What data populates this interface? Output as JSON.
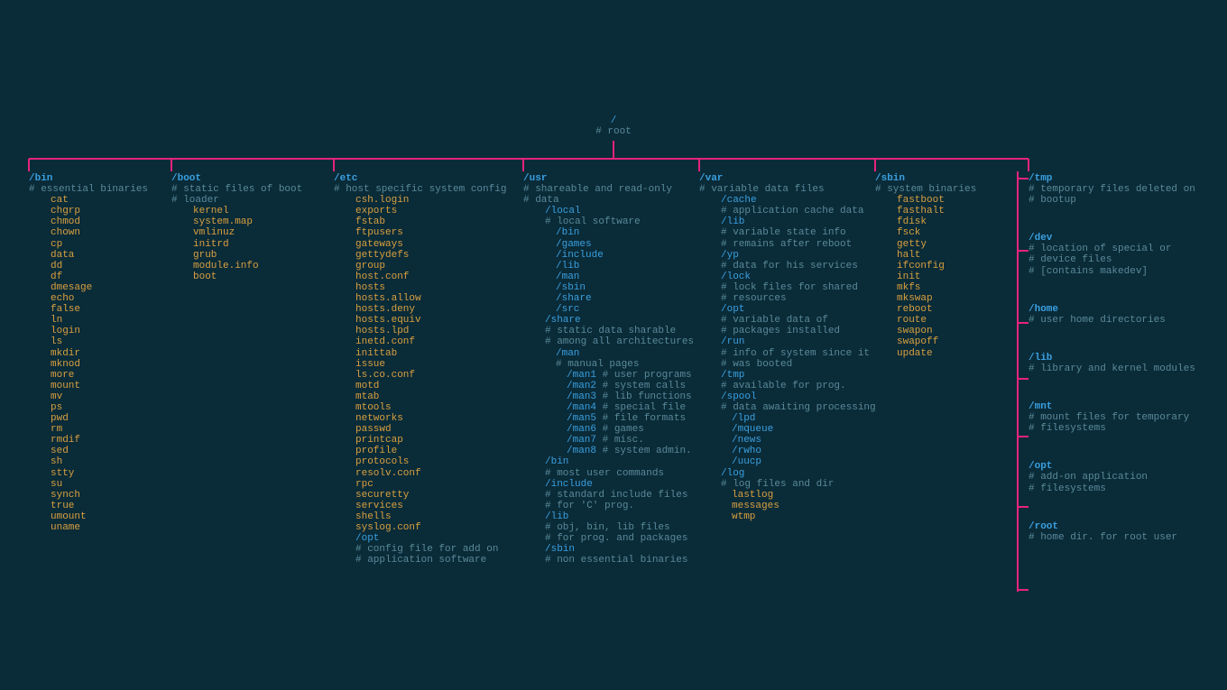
{
  "root": {
    "path": "/",
    "comment": "# root"
  },
  "bin": {
    "path": "/bin",
    "comment": "# essential binaries",
    "files": [
      "cat",
      "chgrp",
      "chmod",
      "chown",
      "cp",
      "data",
      "dd",
      "df",
      "dmesage",
      "echo",
      "false",
      "ln",
      "login",
      "ls",
      "mkdir",
      "mknod",
      "more",
      "mount",
      "mv",
      "ps",
      "pwd",
      "rm",
      "rmdif",
      "sed",
      "sh",
      "stty",
      "su",
      "synch",
      "true",
      "umount",
      "uname"
    ]
  },
  "boot": {
    "path": "/boot",
    "comments": [
      "# static files of boot",
      "# loader"
    ],
    "files": [
      "kernel",
      "system.map",
      "vmlinuz",
      "initrd",
      "grub",
      "module.info",
      "boot"
    ]
  },
  "etc": {
    "path": "/etc",
    "comment": "# host specific system config",
    "files": [
      "csh.login",
      "exports",
      "fstab",
      "ftpusers",
      "gateways",
      "gettydefs",
      "group",
      "host.conf",
      "hosts",
      "hosts.allow",
      "hosts.deny",
      "hosts.equiv",
      "hosts.lpd",
      "inetd.conf",
      "inittab",
      "issue",
      "ls.co.conf",
      "motd",
      "mtab",
      "mtools",
      "networks",
      "passwd",
      "printcap",
      "profile",
      "protocols",
      "resolv.conf",
      "rpc",
      "securetty",
      "services",
      "shells",
      "syslog.conf"
    ],
    "opt": {
      "path": "/opt",
      "comments": [
        "# config file for add on",
        "# application software"
      ]
    }
  },
  "usr": {
    "path": "/usr",
    "comments": [
      "# shareable and read-only",
      "# data"
    ],
    "local": {
      "path": "/local",
      "comment": "# local software",
      "subs": [
        "/bin",
        "/games",
        "/include",
        "/lib",
        "/man",
        "/sbin",
        "/share",
        "/src"
      ]
    },
    "share": {
      "path": "/share",
      "comments": [
        "# static data sharable",
        "# among all architectures"
      ],
      "man": {
        "path": "/man",
        "comment": "# manual pages",
        "items": [
          {
            "p": "/man1",
            "c": "# user programs"
          },
          {
            "p": "/man2",
            "c": "# system calls"
          },
          {
            "p": "/man3",
            "c": "# lib functions"
          },
          {
            "p": "/man4",
            "c": "# special file"
          },
          {
            "p": "/man5",
            "c": "# file formats"
          },
          {
            "p": "/man6",
            "c": "# games"
          },
          {
            "p": "/man7",
            "c": "# misc."
          },
          {
            "p": "/man8",
            "c": "# system admin."
          }
        ]
      }
    },
    "extra": [
      {
        "p": "/bin",
        "cs": [
          "# most user commands"
        ]
      },
      {
        "p": "/include",
        "cs": [
          "# standard include files",
          "# for 'C' prog."
        ]
      },
      {
        "p": "/lib",
        "cs": [
          "# obj, bin, lib files",
          "# for prog. and packages"
        ]
      },
      {
        "p": "/sbin",
        "cs": [
          "# non essential binaries"
        ]
      }
    ]
  },
  "var": {
    "path": "/var",
    "comment": "# variable data files",
    "items": [
      {
        "p": "/cache",
        "cs": [
          "# application cache data"
        ]
      },
      {
        "p": "/lib",
        "cs": [
          "# variable state info",
          "# remains after reboot"
        ]
      },
      {
        "p": "/yp",
        "cs": [
          "# data for his services"
        ]
      },
      {
        "p": "/lock",
        "cs": [
          "# lock files for shared",
          "# resources"
        ]
      },
      {
        "p": "/opt",
        "cs": [
          "# variable data of",
          "# packages installed"
        ]
      },
      {
        "p": "/run",
        "cs": [
          "# info of system since it",
          "# was booted"
        ]
      },
      {
        "p": "/tmp",
        "cs": [
          "# available for prog."
        ]
      },
      {
        "p": "/spool",
        "cs": [
          "# data awaiting processing"
        ],
        "subs": [
          "/lpd",
          "/mqueue",
          "/news",
          "/rwho",
          "/uucp"
        ]
      },
      {
        "p": "/log",
        "cs": [
          "# log files and dir"
        ],
        "files": [
          "lastlog",
          "messages",
          "wtmp"
        ]
      }
    ]
  },
  "sbin": {
    "path": "/sbin",
    "comment": "# system binaries",
    "files": [
      "fastboot",
      "fasthalt",
      "fdisk",
      "fsck",
      "getty",
      "halt",
      "ifconfig",
      "init",
      "mkfs",
      "mkswap",
      "reboot",
      "route",
      "swapon",
      "swapoff",
      "update"
    ]
  },
  "right": [
    {
      "p": "/tmp",
      "cs": [
        "# temporary files deleted on",
        "# bootup"
      ]
    },
    {
      "p": "/dev",
      "cs": [
        "# location of special or",
        "# device files",
        "# [contains makedev]"
      ]
    },
    {
      "p": "/home",
      "cs": [
        "# user home directories"
      ]
    },
    {
      "p": "/lib",
      "cs": [
        "# library and kernel modules"
      ]
    },
    {
      "p": "/mnt",
      "cs": [
        "# mount files for temporary",
        "# filesystems"
      ]
    },
    {
      "p": "/opt",
      "cs": [
        "# add-on application",
        "# filesystems"
      ]
    },
    {
      "p": "/root",
      "cs": [
        "# home dir. for root user"
      ]
    }
  ]
}
